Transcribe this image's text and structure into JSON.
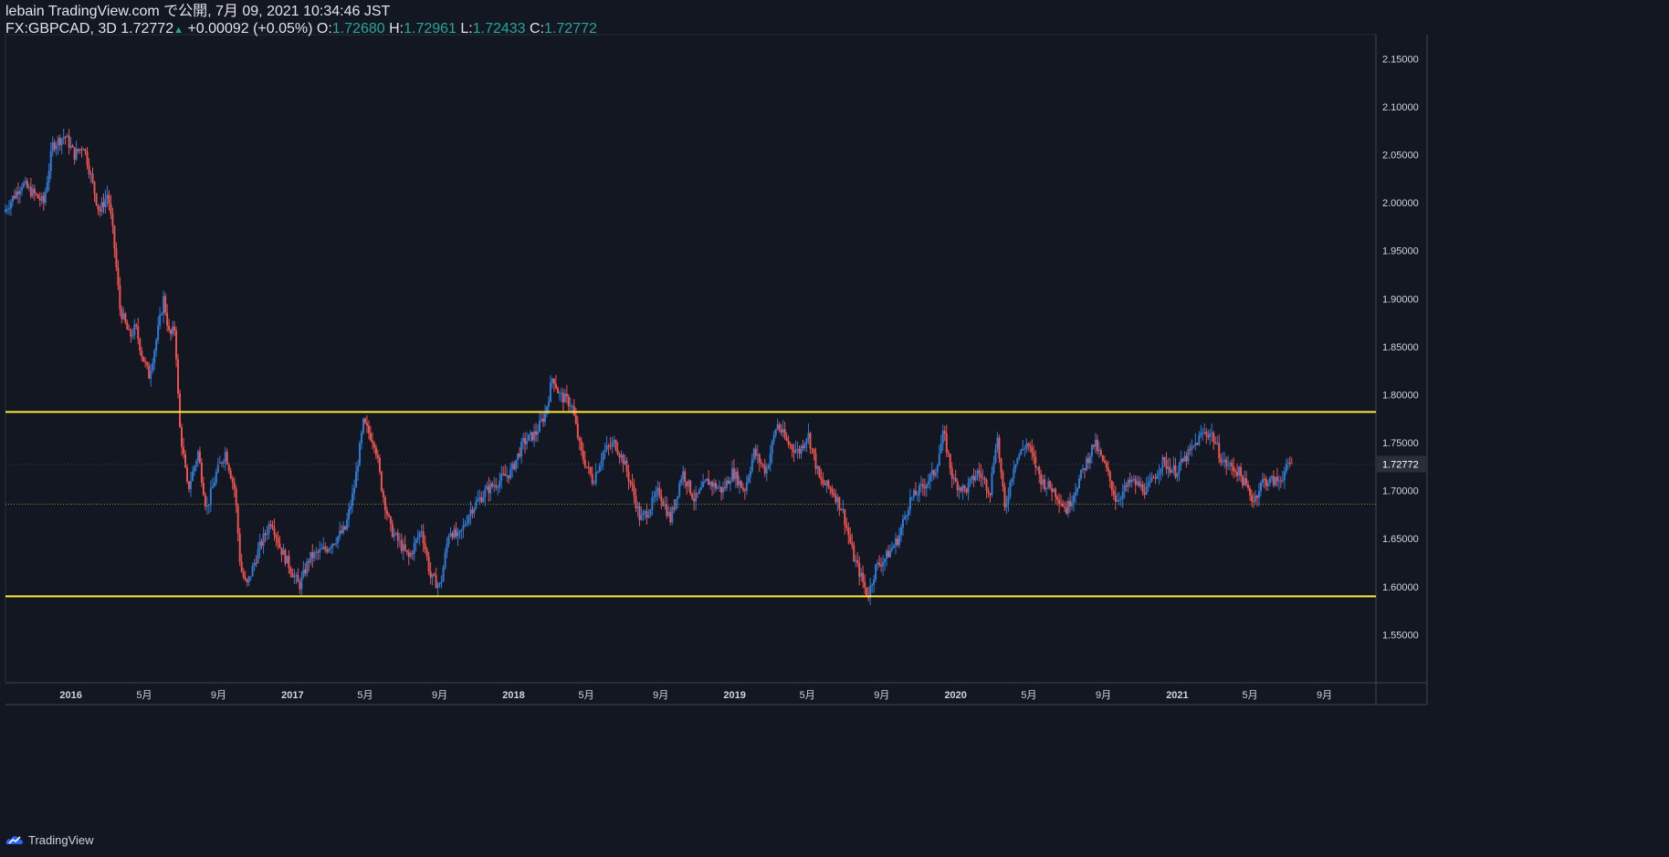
{
  "header": {
    "publish_line": "lebain TradingView.com で公開, 7月 09, 2021 10:34:46 JST",
    "symbol_line": "FX:GBPCAD, 3D",
    "last": "1.72772",
    "change": "+0.00092 (+0.05%)",
    "o_label": "O:",
    "o_value": "1.72680",
    "h_label": "H:",
    "h_value": "1.72961",
    "l_label": "L:",
    "l_value": "1.72433",
    "c_label": "C:",
    "c_value": "1.72772"
  },
  "brand": {
    "label": "TradingView"
  },
  "colors": {
    "background": "#131722",
    "up": "#2f7bd4",
    "down": "#ef5350",
    "level_line": "#ffeb3b",
    "grid": "#1e2230",
    "text": "#d1d4dc"
  },
  "chart_data": {
    "type": "candlestick",
    "symbol": "FX:GBPCAD",
    "interval": "3D",
    "y_ticks": [
      "1.55000",
      "1.60000",
      "1.65000",
      "1.70000",
      "1.75000",
      "1.80000",
      "1.85000",
      "1.90000",
      "1.95000",
      "2.00000",
      "2.05000",
      "2.10000",
      "2.15000"
    ],
    "ylim": [
      1.5,
      2.175
    ],
    "x_ticks": [
      {
        "label": "2016",
        "date": "2016-01-01",
        "bold": true
      },
      {
        "label": "5月",
        "date": "2016-05-01"
      },
      {
        "label": "9月",
        "date": "2016-09-01"
      },
      {
        "label": "2017",
        "date": "2017-01-01",
        "bold": true
      },
      {
        "label": "5月",
        "date": "2017-05-01"
      },
      {
        "label": "9月",
        "date": "2017-09-01"
      },
      {
        "label": "2018",
        "date": "2018-01-01",
        "bold": true
      },
      {
        "label": "5月",
        "date": "2018-05-01"
      },
      {
        "label": "9月",
        "date": "2018-09-01"
      },
      {
        "label": "2019",
        "date": "2019-01-01",
        "bold": true
      },
      {
        "label": "5月",
        "date": "2019-05-01"
      },
      {
        "label": "9月",
        "date": "2019-09-01"
      },
      {
        "label": "2020",
        "date": "2020-01-01",
        "bold": true
      },
      {
        "label": "5月",
        "date": "2020-05-01"
      },
      {
        "label": "9月",
        "date": "2020-09-01"
      },
      {
        "label": "2021",
        "date": "2021-01-01",
        "bold": true
      },
      {
        "label": "5月",
        "date": "2021-05-01"
      },
      {
        "label": "9月",
        "date": "2021-09-01"
      }
    ],
    "xlim": [
      "2015-09-15",
      "2021-11-25"
    ],
    "horizontal_lines": [
      {
        "price": 1.782,
        "style": "solid",
        "color": "#ffeb3b"
      },
      {
        "price": 1.59,
        "style": "solid",
        "color": "#ffeb3b"
      },
      {
        "price": 1.686,
        "style": "dotted",
        "color": "#8d8a3a"
      }
    ],
    "current_price": {
      "value": 1.72772,
      "label": "1.72772"
    },
    "price_path": [
      [
        "2015-09-15",
        1.99
      ],
      [
        "2015-10-15",
        2.02
      ],
      [
        "2015-11-20",
        2.0
      ],
      [
        "2015-12-05",
        2.06
      ],
      [
        "2015-12-25",
        2.07
      ],
      [
        "2016-01-10",
        2.05
      ],
      [
        "2016-01-25",
        2.06
      ],
      [
        "2016-02-05",
        2.03
      ],
      [
        "2016-02-20",
        1.99
      ],
      [
        "2016-03-05",
        2.01
      ],
      [
        "2016-03-15",
        1.96
      ],
      [
        "2016-03-25",
        1.89
      ],
      [
        "2016-04-10",
        1.86
      ],
      [
        "2016-04-20",
        1.87
      ],
      [
        "2016-05-01",
        1.84
      ],
      [
        "2016-05-12",
        1.82
      ],
      [
        "2016-05-25",
        1.86
      ],
      [
        "2016-06-05",
        1.9
      ],
      [
        "2016-06-15",
        1.86
      ],
      [
        "2016-06-24",
        1.87
      ],
      [
        "2016-07-01",
        1.77
      ],
      [
        "2016-07-15",
        1.7
      ],
      [
        "2016-08-01",
        1.74
      ],
      [
        "2016-08-15",
        1.68
      ],
      [
        "2016-09-01",
        1.72
      ],
      [
        "2016-09-15",
        1.74
      ],
      [
        "2016-10-01",
        1.7
      ],
      [
        "2016-10-10",
        1.62
      ],
      [
        "2016-10-20",
        1.6
      ],
      [
        "2016-11-10",
        1.64
      ],
      [
        "2016-11-30",
        1.67
      ],
      [
        "2016-12-15",
        1.64
      ],
      [
        "2016-12-31",
        1.62
      ],
      [
        "2017-01-15",
        1.6
      ],
      [
        "2017-02-01",
        1.63
      ],
      [
        "2017-03-01",
        1.64
      ],
      [
        "2017-04-01",
        1.66
      ],
      [
        "2017-04-15",
        1.7
      ],
      [
        "2017-05-01",
        1.77
      ],
      [
        "2017-05-20",
        1.75
      ],
      [
        "2017-06-01",
        1.7
      ],
      [
        "2017-06-15",
        1.66
      ],
      [
        "2017-07-15",
        1.63
      ],
      [
        "2017-08-05",
        1.66
      ],
      [
        "2017-08-20",
        1.61
      ],
      [
        "2017-09-05",
        1.6
      ],
      [
        "2017-09-20",
        1.66
      ],
      [
        "2017-10-05",
        1.65
      ],
      [
        "2017-10-25",
        1.68
      ],
      [
        "2017-11-20",
        1.7
      ],
      [
        "2017-12-10",
        1.71
      ],
      [
        "2017-12-31",
        1.72
      ],
      [
        "2018-01-20",
        1.75
      ],
      [
        "2018-02-10",
        1.76
      ],
      [
        "2018-02-25",
        1.78
      ],
      [
        "2018-03-10",
        1.82
      ],
      [
        "2018-03-20",
        1.8
      ],
      [
        "2018-04-10",
        1.79
      ],
      [
        "2018-04-25",
        1.74
      ],
      [
        "2018-05-15",
        1.71
      ],
      [
        "2018-06-01",
        1.74
      ],
      [
        "2018-06-20",
        1.75
      ],
      [
        "2018-07-05",
        1.73
      ],
      [
        "2018-07-20",
        1.7
      ],
      [
        "2018-08-01",
        1.67
      ],
      [
        "2018-08-15",
        1.68
      ],
      [
        "2018-09-01",
        1.7
      ],
      [
        "2018-09-20",
        1.67
      ],
      [
        "2018-10-10",
        1.72
      ],
      [
        "2018-10-30",
        1.69
      ],
      [
        "2018-11-20",
        1.71
      ],
      [
        "2018-12-15",
        1.7
      ],
      [
        "2019-01-01",
        1.72
      ],
      [
        "2019-01-20",
        1.7
      ],
      [
        "2019-02-05",
        1.74
      ],
      [
        "2019-02-25",
        1.72
      ],
      [
        "2019-03-15",
        1.77
      ],
      [
        "2019-04-01",
        1.75
      ],
      [
        "2019-04-20",
        1.74
      ],
      [
        "2019-05-05",
        1.76
      ],
      [
        "2019-05-25",
        1.71
      ],
      [
        "2019-06-15",
        1.7
      ],
      [
        "2019-07-01",
        1.68
      ],
      [
        "2019-07-20",
        1.63
      ],
      [
        "2019-08-01",
        1.61
      ],
      [
        "2019-08-12",
        1.59
      ],
      [
        "2019-08-25",
        1.62
      ],
      [
        "2019-09-10",
        1.63
      ],
      [
        "2019-10-01",
        1.65
      ],
      [
        "2019-10-20",
        1.69
      ],
      [
        "2019-11-05",
        1.7
      ],
      [
        "2019-12-01",
        1.72
      ],
      [
        "2019-12-15",
        1.76
      ],
      [
        "2019-12-31",
        1.71
      ],
      [
        "2020-01-20",
        1.7
      ],
      [
        "2020-02-10",
        1.72
      ],
      [
        "2020-03-01",
        1.7
      ],
      [
        "2020-03-12",
        1.76
      ],
      [
        "2020-03-25",
        1.68
      ],
      [
        "2020-04-10",
        1.73
      ],
      [
        "2020-05-01",
        1.75
      ],
      [
        "2020-05-25",
        1.71
      ],
      [
        "2020-06-15",
        1.7
      ],
      [
        "2020-07-05",
        1.68
      ],
      [
        "2020-07-25",
        1.71
      ],
      [
        "2020-08-20",
        1.75
      ],
      [
        "2020-09-10",
        1.72
      ],
      [
        "2020-09-25",
        1.69
      ],
      [
        "2020-10-20",
        1.71
      ],
      [
        "2020-11-15",
        1.7
      ],
      [
        "2020-12-10",
        1.73
      ],
      [
        "2021-01-01",
        1.72
      ],
      [
        "2021-01-25",
        1.74
      ],
      [
        "2021-02-15",
        1.76
      ],
      [
        "2021-03-01",
        1.76
      ],
      [
        "2021-03-20",
        1.73
      ],
      [
        "2021-04-15",
        1.72
      ],
      [
        "2021-05-01",
        1.7
      ],
      [
        "2021-05-10",
        1.69
      ],
      [
        "2021-05-25",
        1.71
      ],
      [
        "2021-06-20",
        1.71
      ],
      [
        "2021-07-09",
        1.72772
      ]
    ]
  }
}
